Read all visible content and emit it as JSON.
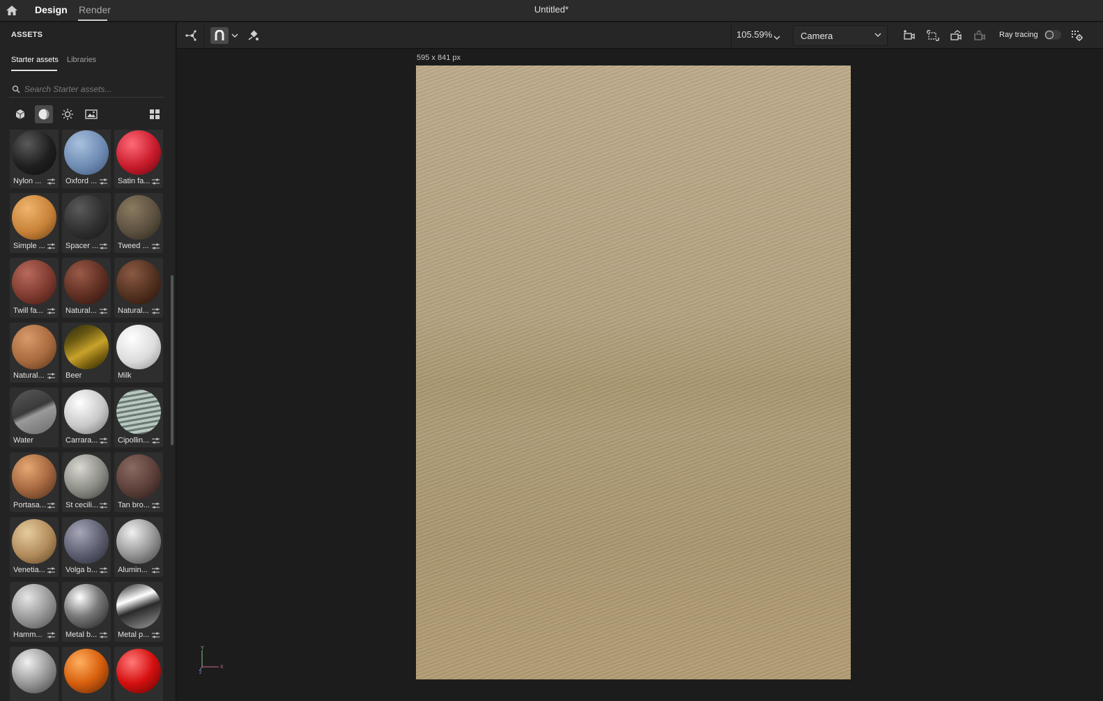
{
  "topbar": {
    "tab_design": "Design",
    "tab_render": "Render",
    "doc_title": "Untitled*"
  },
  "assets": {
    "title": "ASSETS",
    "subtab_starter": "Starter assets",
    "subtab_libraries": "Libraries",
    "search_placeholder": "Search Starter assets...",
    "filters": [
      "model-icon",
      "material-icon",
      "light-icon",
      "image-icon"
    ],
    "active_filter": "material-icon",
    "materials": [
      {
        "label": "Nylon ...",
        "adjust": true
      },
      {
        "label": "Oxford ...",
        "adjust": true
      },
      {
        "label": "Satin fa...",
        "adjust": true
      },
      {
        "label": "Simple ...",
        "adjust": true
      },
      {
        "label": "Spacer ...",
        "adjust": true
      },
      {
        "label": "Tweed ...",
        "adjust": true
      },
      {
        "label": "Twill fa...",
        "adjust": true
      },
      {
        "label": "Natural...",
        "adjust": true
      },
      {
        "label": "Natural...",
        "adjust": true
      },
      {
        "label": "Natural...",
        "adjust": true
      },
      {
        "label": "Beer",
        "adjust": false
      },
      {
        "label": "Milk",
        "adjust": false
      },
      {
        "label": "Water",
        "adjust": false
      },
      {
        "label": "Carrara...",
        "adjust": true
      },
      {
        "label": "Cipollin...",
        "adjust": true
      },
      {
        "label": "Portasa...",
        "adjust": true
      },
      {
        "label": "St cecili...",
        "adjust": true
      },
      {
        "label": "Tan bro...",
        "adjust": true
      },
      {
        "label": "Venetia...",
        "adjust": true
      },
      {
        "label": "Volga b...",
        "adjust": true
      },
      {
        "label": "Alumin...",
        "adjust": true
      },
      {
        "label": "Hamm...",
        "adjust": true
      },
      {
        "label": "Metal b...",
        "adjust": true
      },
      {
        "label": "Metal p...",
        "adjust": true
      },
      {
        "label": "",
        "adjust": false
      },
      {
        "label": "",
        "adjust": false
      },
      {
        "label": "",
        "adjust": false
      }
    ]
  },
  "toolbar": {
    "zoom": "105.59%",
    "camera": "Camera",
    "ray_tracing_label": "Ray tracing",
    "ray_tracing_on": false
  },
  "canvas": {
    "size_label": "595 x 841 px",
    "axis_y": "Y",
    "axis_x": "X",
    "axis_z": "Z"
  },
  "colors": {
    "accent": "#ffffff",
    "panel_bg": "#232323",
    "canvas_bg": "#1c1c1c"
  }
}
